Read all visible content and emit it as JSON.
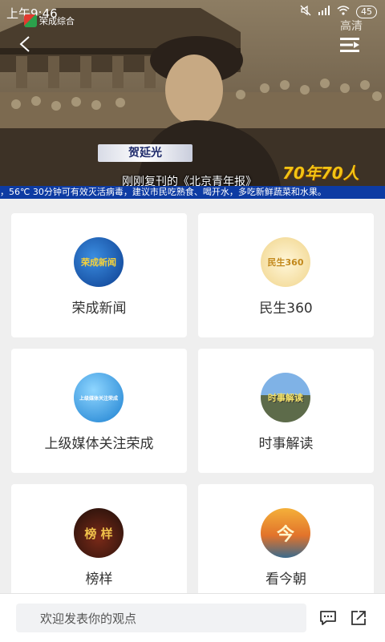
{
  "status_bar": {
    "time": "上午9:46",
    "battery": "45"
  },
  "player": {
    "channel_name": "荣成综合",
    "quality_label": "高清",
    "name_plate": "贺延光",
    "subtitle": "刚刚复刊的《北京青年报》",
    "badge": "70年70人",
    "ticker": "，56℃ 30分钟可有效灭活病毒，建议市民吃熟食、喝开水，多吃新鲜蔬菜和水果。"
  },
  "cards": [
    {
      "label": "荣成新闻",
      "thumb_text": "荣成新闻",
      "icon": "rongcheng-news-thumbnail"
    },
    {
      "label": "民生360",
      "thumb_text": "民生360",
      "icon": "minsheng-360-thumbnail"
    },
    {
      "label": "上级媒体关注荣成",
      "thumb_text": "上级媒体关注荣成",
      "icon": "media-attention-thumbnail"
    },
    {
      "label": "时事解读",
      "thumb_text": "时事解读",
      "icon": "current-affairs-thumbnail"
    },
    {
      "label": "榜样",
      "thumb_text": "榜 样",
      "icon": "role-model-thumbnail"
    },
    {
      "label": "看今朝",
      "thumb_text": "今",
      "icon": "today-thumbnail"
    }
  ],
  "bottom_bar": {
    "comment_placeholder": "欢迎发表你的观点"
  },
  "colors": {
    "ticker_bg": "#0d3ba3",
    "page_bg": "#efefef",
    "badge": "#f2c313"
  }
}
